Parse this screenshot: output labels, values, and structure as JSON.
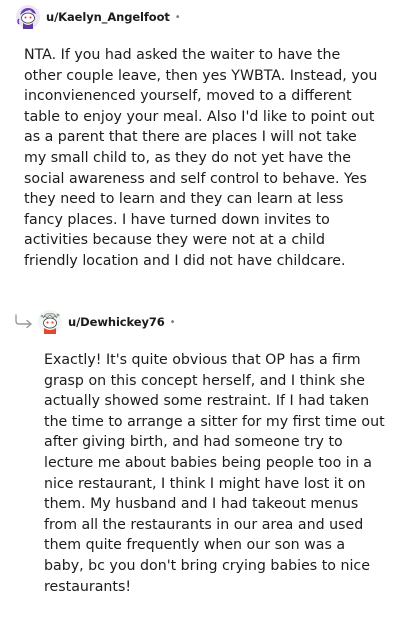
{
  "comments": [
    {
      "username": "u/Kaelyn_Angelfoot",
      "separator": "•",
      "avatar_icon": "snoo-purple-avatar-icon",
      "body": "NTA. If you had asked the waiter to have the other couple leave, then yes YWBTA. Instead, you inconvienenced yourself, moved to a different table to enjoy your meal. Also I'd like to point out as a parent that there are places I will not take my small child to, as they do not yet have the social awareness and self control to behave. Yes they need to learn and they can learn at less fancy places. I have turned down invites to activities because they were not at a child friendly location and I did not have childcare."
    },
    {
      "username": "u/Dewhickey76",
      "separator": "•",
      "avatar_icon": "snoo-red-white-avatar-icon",
      "reply_icon": "reply-arrow-icon",
      "body": "Exactly! It's quite obvious that OP has a firm grasp on this concept herself, and I think she actually showed some restraint. If I had taken the time to arrange a sitter for my first time out after giving birth, and had someone try to lecture me about babies being people too in a nice restaurant, I think I might have lost it on them. My husband and I had takeout menus from all the restaurants in our area and used them quite frequently when our son was a baby, bc you don't bring crying babies to nice restaurants!"
    }
  ]
}
